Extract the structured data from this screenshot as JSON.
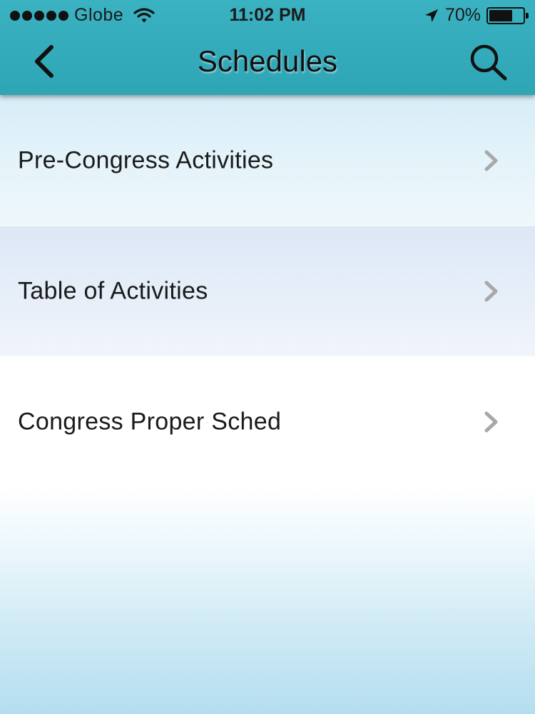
{
  "status_bar": {
    "carrier": "Globe",
    "time": "11:02 PM",
    "battery_percent": "70%",
    "battery_level": 0.7,
    "signal_bars": 5
  },
  "nav": {
    "title": "Schedules",
    "back_icon": "chevron-left-icon",
    "search_icon": "search-icon"
  },
  "menu": {
    "items": [
      {
        "label": "Pre-Congress Activities"
      },
      {
        "label": "Table of Activities"
      },
      {
        "label": "Congress Proper Sched"
      }
    ]
  },
  "colors": {
    "navbar": "#35abbb",
    "chevron": "#a8a8a8",
    "text": "#1a1a1a"
  }
}
